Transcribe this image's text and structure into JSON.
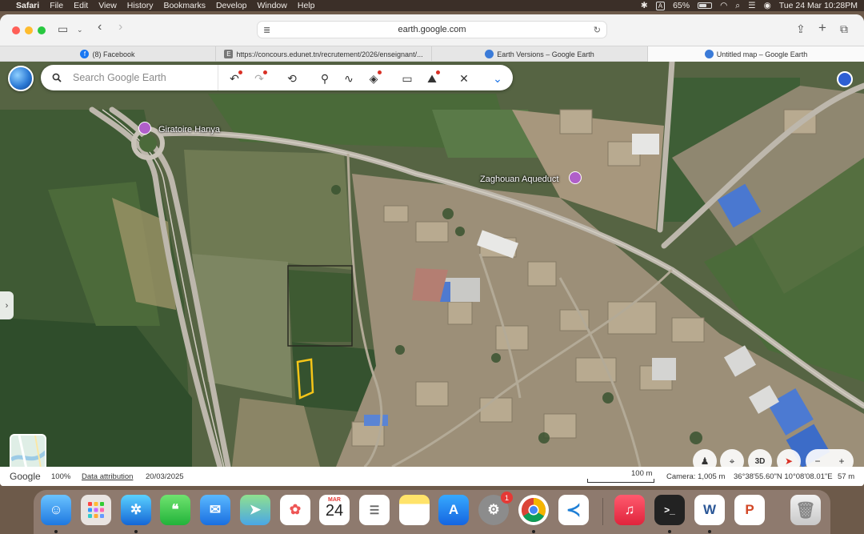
{
  "menubar": {
    "app": "Safari",
    "items": [
      "File",
      "Edit",
      "View",
      "History",
      "Bookmarks",
      "Develop",
      "Window",
      "Help"
    ],
    "keyboard": "A",
    "battery": "65%",
    "battery_level": 0.65,
    "datetime": "Tue 24 Mar  10:28PM"
  },
  "browser": {
    "url": "earth.google.com",
    "tabs": [
      {
        "title": "(8) Facebook",
        "active": false
      },
      {
        "title": "https://concours.edunet.tn/recrutement/2026/enseignant/...",
        "active": false
      },
      {
        "title": "Earth Versions – Google Earth",
        "active": false
      },
      {
        "title": "Untitled map – Google Earth",
        "active": true
      }
    ]
  },
  "earth": {
    "search_placeholder": "Search Google Earth",
    "tools": [
      "undo-icon",
      "redo-icon",
      "history-icon",
      "placemark-icon",
      "path-icon",
      "layers-icon",
      "measure-icon",
      "image-overlay-icon",
      "tools-icon",
      "chevron-down-icon"
    ],
    "labels": {
      "roundabout": "Giratoire Hanya",
      "aqueduct": "Zaghouan Aqueduct"
    },
    "controls": {
      "three_d": "3D"
    }
  },
  "status": {
    "provider": "Google",
    "zoom": "100%",
    "attribution": "Data attribution",
    "date": "20/03/2025",
    "scale": "100 m",
    "camera": "Camera: 1,005 m",
    "coords": "36°38'55.60\"N 10°08'08.01\"E",
    "elevation": "57 m"
  },
  "dock": {
    "calendar_month": "MAR",
    "calendar_day": "24",
    "settings_badge": "1"
  }
}
